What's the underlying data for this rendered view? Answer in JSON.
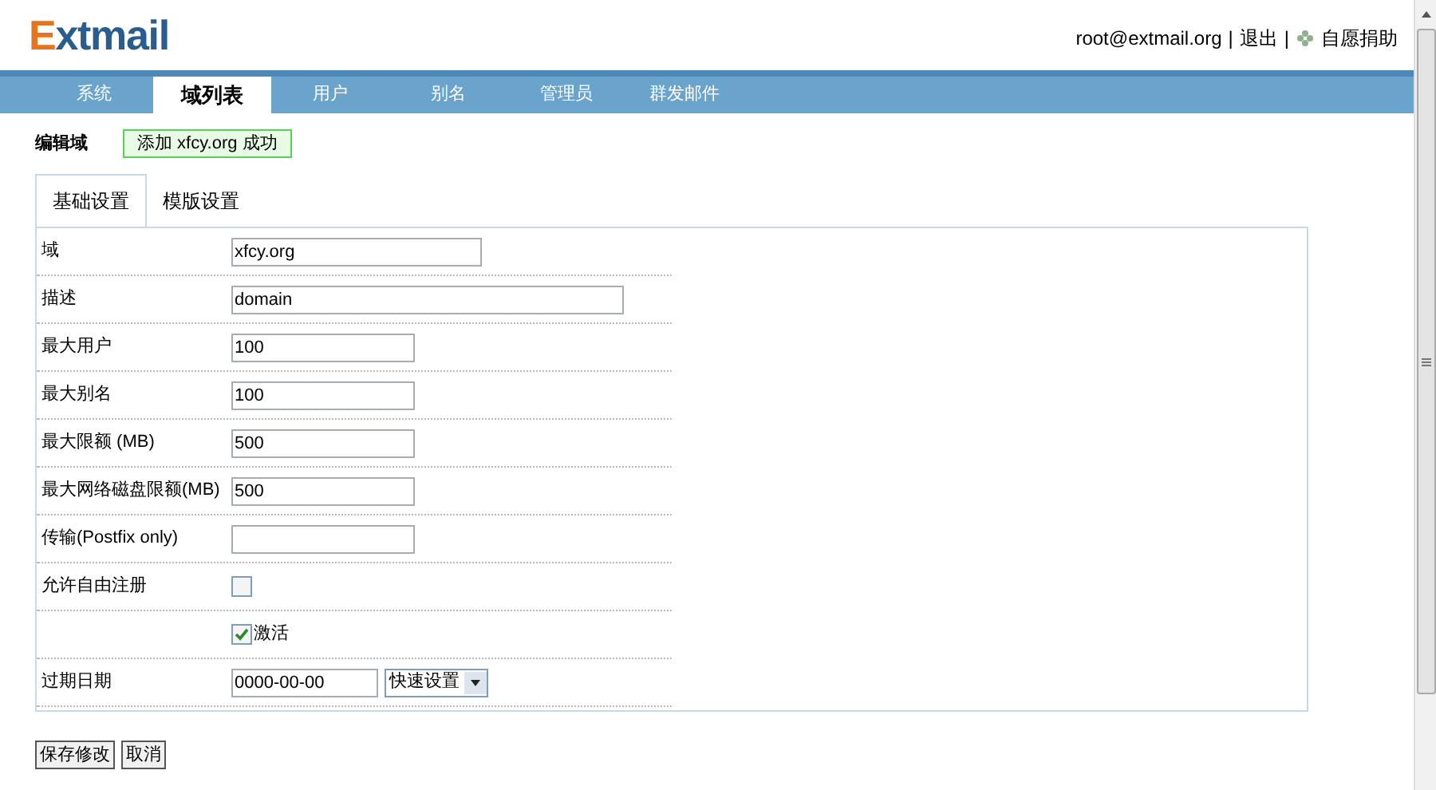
{
  "header": {
    "logo": "Extmail",
    "user": "root@extmail.org",
    "separator_1": "|",
    "logout": "退出",
    "separator_2": "|",
    "donate": "自愿捐助"
  },
  "nav": [
    {
      "label": "系统",
      "selected": false
    },
    {
      "label": "域列表",
      "selected": true
    },
    {
      "label": "用户",
      "selected": false
    },
    {
      "label": "别名",
      "selected": false
    },
    {
      "label": "管理员",
      "selected": false
    },
    {
      "label": "群发邮件",
      "selected": false
    }
  ],
  "page_title": "编辑域",
  "message": "添加 xfcy.org 成功",
  "sub_tabs": [
    {
      "label": "基础设置",
      "selected": true
    },
    {
      "label": "模版设置",
      "selected": false
    }
  ],
  "rows": [
    {
      "label": "域",
      "kind": "medium",
      "value": "xfcy.org"
    },
    {
      "label": "描述",
      "kind": "long",
      "value": "domain"
    },
    {
      "label": "最大用户",
      "kind": "short",
      "value": "100"
    },
    {
      "label": "最大别名",
      "kind": "short",
      "value": "100"
    },
    {
      "label": "最大限额 (MB)",
      "kind": "short",
      "value": "500"
    },
    {
      "label": "最大网络磁盘限额(MB)",
      "kind": "short",
      "value": "500"
    },
    {
      "label": "传输(Postfix only)",
      "kind": "short"
    },
    {
      "label": "允许自由注册",
      "kind": "checkbox",
      "checked": false
    },
    {
      "kind": "checkbox",
      "checked": true,
      "text": "激活"
    },
    {
      "label": "过期日期",
      "kind": "date",
      "value": "0000-00-00",
      "select": "快速设置"
    }
  ],
  "buttons": [
    "保存修改",
    "取消"
  ]
}
